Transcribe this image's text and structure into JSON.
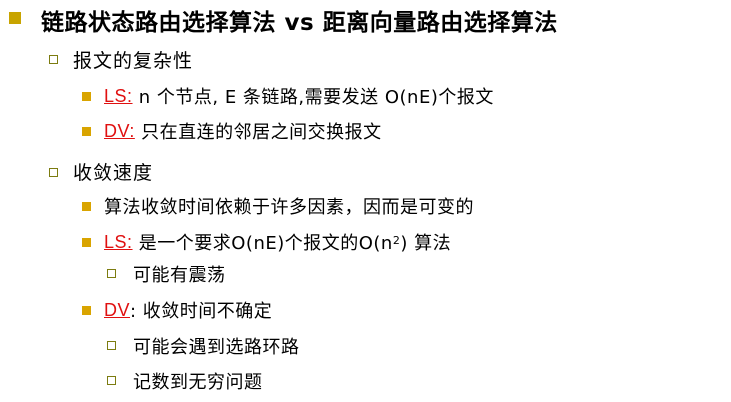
{
  "title": "链路状态路由选择算法 vs 距离向量路由选择算法",
  "sections": [
    {
      "heading": "报文的复杂性",
      "items": [
        {
          "tag": "LS:",
          "text_a": " n 个节点, E 条链路,需要发送 O(nE)个报文"
        },
        {
          "tag": "DV:",
          "text_a": " 只在直连的邻居之间交换报文"
        }
      ]
    },
    {
      "heading": "收敛速度",
      "items": [
        {
          "text_a": "算法收敛时间依赖于许多因素，因而是可变的"
        },
        {
          "tag": "LS:",
          "text_a": " 是一个要求O(nE)个报文的O(n",
          "sup": "2",
          "text_b": ") 算法",
          "subitems": [
            "可能有震荡"
          ]
        },
        {
          "tag": "DV",
          "text_a": ": 收敛时间不确定",
          "subitems": [
            "可能会遇到选路环路",
            "记数到无穷问题"
          ]
        }
      ]
    }
  ],
  "colors": {
    "level1_bullet": "#c8a400",
    "level3_bullet": "#d9a400",
    "hollow_bullet_border": "#7c7c10",
    "tag_red": "#e01010"
  }
}
